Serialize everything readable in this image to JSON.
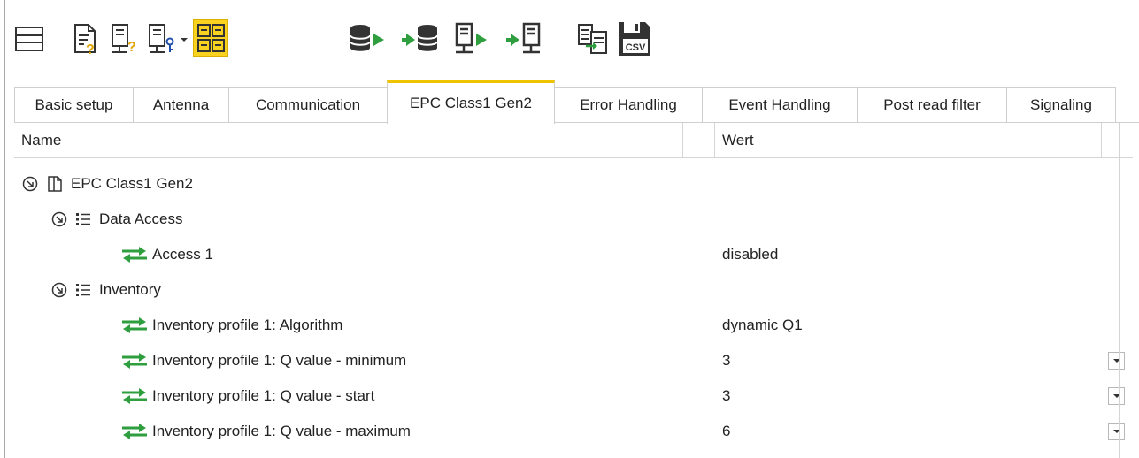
{
  "toolbar": {
    "icons": [
      "panel-layout-icon",
      "document-help-icon",
      "reader-help-icon",
      "reader-key-icon",
      "grid-view-icon",
      "database-export-icon",
      "database-import-icon",
      "reader-export-icon",
      "reader-import-icon",
      "compare-list-icon",
      "save-csv-icon"
    ],
    "csv_label": "CSV",
    "active_color": "#f8d21e",
    "accent_green": "#2e9e3e"
  },
  "tabs": [
    {
      "label": "Basic setup",
      "active": false
    },
    {
      "label": "Antenna",
      "active": false
    },
    {
      "label": "Communication",
      "active": false
    },
    {
      "label": "EPC Class1 Gen2",
      "active": true
    },
    {
      "label": "Error Handling",
      "active": false
    },
    {
      "label": "Event Handling",
      "active": false
    },
    {
      "label": "Post read filter",
      "active": false
    },
    {
      "label": "Signaling",
      "active": false
    }
  ],
  "grid": {
    "columns": {
      "name": "Name",
      "value": "Wert"
    },
    "rows": [
      {
        "label": "EPC Class1 Gen2",
        "value": "",
        "level": 0,
        "icon": "tag-icon",
        "expander": true,
        "dropdown": false
      },
      {
        "label": "Data Access",
        "value": "",
        "level": 1,
        "icon": "list-icon",
        "expander": true,
        "dropdown": false
      },
      {
        "label": "Access 1",
        "value": "disabled",
        "level": 2,
        "icon": "read-write-arrows-icon",
        "expander": false,
        "dropdown": false
      },
      {
        "label": "Inventory",
        "value": "",
        "level": 1,
        "icon": "list-icon",
        "expander": true,
        "dropdown": false
      },
      {
        "label": "Inventory profile 1: Algorithm",
        "value": "dynamic Q1",
        "level": 2,
        "icon": "read-write-arrows-icon",
        "expander": false,
        "dropdown": false
      },
      {
        "label": "Inventory profile 1: Q value - minimum",
        "value": "3",
        "level": 2,
        "icon": "read-write-arrows-icon",
        "expander": false,
        "dropdown": true
      },
      {
        "label": "Inventory profile 1: Q value - start",
        "value": "3",
        "level": 2,
        "icon": "read-write-arrows-icon",
        "expander": false,
        "dropdown": true
      },
      {
        "label": "Inventory profile 1: Q value - maximum",
        "value": "6",
        "level": 2,
        "icon": "read-write-arrows-icon",
        "expander": false,
        "dropdown": true
      }
    ]
  }
}
